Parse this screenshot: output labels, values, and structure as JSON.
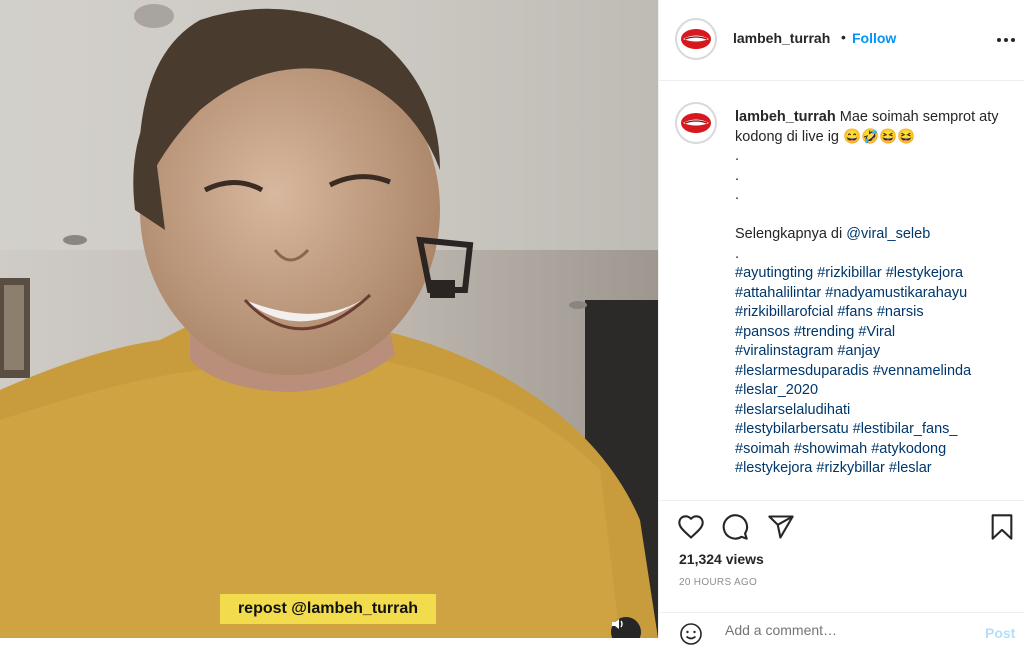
{
  "video": {
    "overlay_text": "repost @lambeh_turrah"
  },
  "header": {
    "username": "lambeh_turrah",
    "separator": "•",
    "follow_label": "Follow"
  },
  "caption": {
    "username": "lambeh_turrah",
    "text": "Mae soimah semprot aty kodong di live ig",
    "emojis": [
      "😄",
      "🤣",
      "😆",
      "😆"
    ],
    "dots": [
      ".",
      ".",
      "."
    ],
    "mention_prefix": "Selengkapnya di ",
    "mention": "@viral_seleb",
    "dot_after_mention": ".",
    "hashtag_lines": [
      "#ayutingting #rizkibillar #lestykejora",
      "#attahalilintar #nadyamustikarahayu",
      "#rizkibillarofcial #fans #narsis",
      "#pansos #trending #Viral",
      "#viralinstagram #anjay",
      "#leslarmesduparadis #vennamelinda",
      "#leslar_2020",
      "#leslarselaludihati",
      "#lestybilarbersatu #lestibilar_fans_",
      "#soimah #showimah #atykodong",
      "#lestykejora #rizkybillar #leslar"
    ]
  },
  "stats": {
    "views": "21,324 views",
    "time": "20 HOURS AGO"
  },
  "comment": {
    "placeholder": "Add a comment…",
    "post_label": "Post"
  },
  "colors": {
    "accent": "#0095f6",
    "overlay_bg": "#f2dc4e",
    "hashtag": "#00376b"
  },
  "icons": {
    "header_more": "more-horizontal-icon",
    "like": "heart-icon",
    "comment": "comment-bubble-icon",
    "share": "paper-plane-icon",
    "save": "bookmark-icon",
    "emoji": "smiley-icon",
    "volume": "speaker-icon"
  }
}
